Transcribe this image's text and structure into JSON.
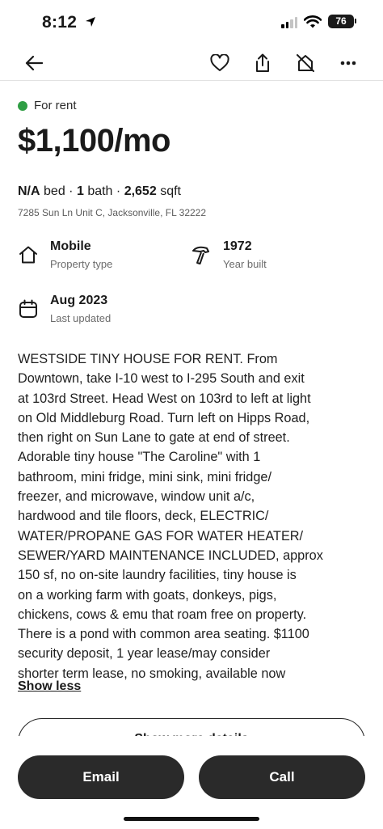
{
  "status_bar": {
    "time": "8:12",
    "battery": "76"
  },
  "nav": {
    "back_icon": "arrow-left-icon",
    "favorite_icon": "heart-icon",
    "share_icon": "share-icon",
    "hide_icon": "hide-home-icon",
    "more_icon": "more-horizontal-icon"
  },
  "listing": {
    "status": "For rent",
    "status_color": "#2f9e44",
    "price": "$1,100/mo",
    "beds_value": "N/A",
    "beds_label": "bed",
    "baths_value": "1",
    "baths_label": "bath",
    "sqft_value": "2,652",
    "sqft_label": "sqft",
    "separator": "·",
    "address": "7285 Sun Ln Unit C, Jacksonville, FL 32222"
  },
  "attributes": [
    {
      "icon": "house-icon",
      "value": "Mobile",
      "label": "Property type"
    },
    {
      "icon": "hammer-icon",
      "value": "1972",
      "label": "Year built"
    },
    {
      "icon": "calendar-icon",
      "value": "Aug 2023",
      "label": "Last updated"
    }
  ],
  "description_lines": [
    "WESTSIDE TINY HOUSE FOR RENT. From",
    "Downtown, take I-10 west to I-295 South and exit",
    "at 103rd Street. Head West on 103rd to left at light",
    "on Old Middleburg Road. Turn left on Hipps Road,",
    "then right on Sun Lane to gate at end of street.",
    "Adorable tiny house \"The Caroline\" with 1",
    "bathroom, mini fridge, mini sink, mini fridge/",
    "freezer, and microwave, window unit a/c,",
    "hardwood and tile floors, deck, ELECTRIC/",
    "WATER/PROPANE GAS FOR WATER HEATER/",
    "SEWER/YARD MAINTENANCE INCLUDED, approx",
    "150 sf, no on-site laundry facilities, tiny house is",
    "on a working farm with goats, donkeys, pigs,",
    "chickens, cows & emu that roam free on property.",
    "There is a pond with common area seating. $1100",
    "security deposit, 1 year lease/may consider",
    "shorter term lease, no smoking, available now"
  ],
  "show_less_label": "Show less",
  "more_details_label": "Show more details",
  "actions": {
    "email_label": "Email",
    "call_label": "Call"
  }
}
